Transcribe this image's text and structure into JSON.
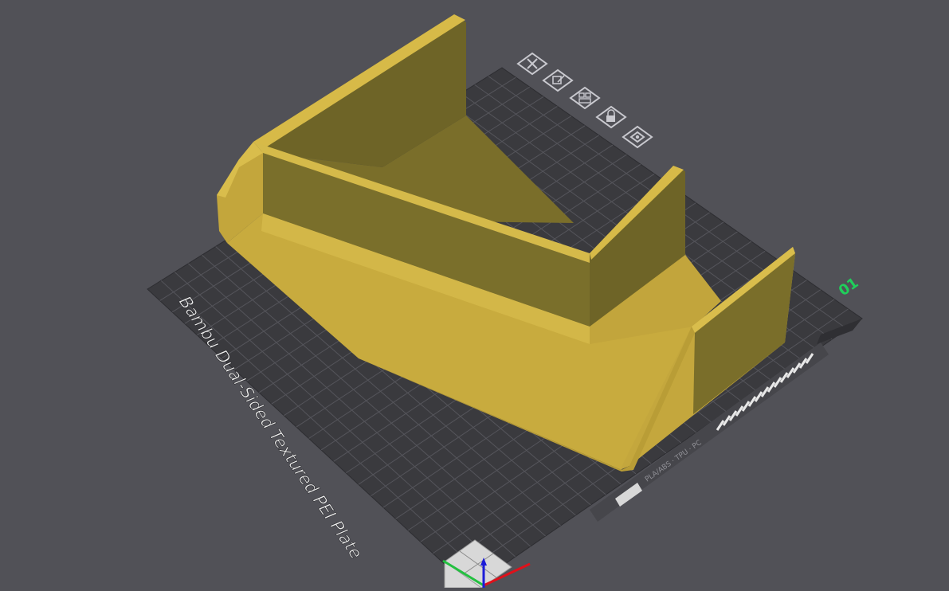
{
  "plate": {
    "name": "Bambu Dual-Sided Textured PEI Plate",
    "index": "01",
    "label_sticker": "PLA/ABS · TPU · PC"
  },
  "plate_toolbar": [
    {
      "icon": "close-icon",
      "title": "Remove plate"
    },
    {
      "icon": "edit-plate-icon",
      "title": "Edit plate"
    },
    {
      "icon": "arrange-icon",
      "title": "Arrange"
    },
    {
      "icon": "lock-icon",
      "title": "Lock"
    },
    {
      "icon": "settings-icon",
      "title": "Plate settings"
    }
  ],
  "colors": {
    "background": "#515157",
    "plate": "#3a3a3e",
    "grid": "#56565c",
    "model": "#c9ac3c",
    "index_label": "#1fcf5a",
    "axis_x": "#e0101a",
    "axis_y": "#23c040",
    "axis_z": "#1c1cd8"
  }
}
